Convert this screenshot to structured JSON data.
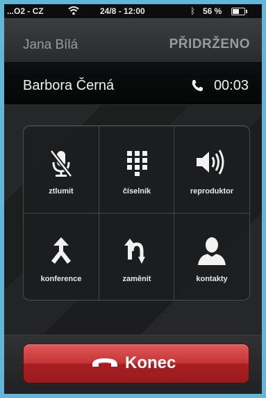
{
  "status_bar": {
    "carrier": "O2 - CZ",
    "signal_prefix": "...",
    "wifi_icon": "wifi-icon",
    "datetime": "24/8 - 12:00",
    "bluetooth_icon": "bluetooth-icon",
    "battery_percent": "56 %",
    "battery_level": 0.56
  },
  "held_call": {
    "name": "Jana Bílá",
    "status": "PŘIDRŽENO"
  },
  "active_call": {
    "name": "Barbora Černá",
    "duration": "00:03"
  },
  "controls": [
    {
      "label": "ztlumit",
      "icon": "mute-icon"
    },
    {
      "label": "číselník",
      "icon": "keypad-icon"
    },
    {
      "label": "reproduktor",
      "icon": "speaker-icon"
    },
    {
      "label": "konference",
      "icon": "merge-calls-icon"
    },
    {
      "label": "zaměnit",
      "icon": "swap-calls-icon"
    },
    {
      "label": "kontakty",
      "icon": "contacts-icon"
    }
  ],
  "end_call": {
    "label": "Konec"
  },
  "colors": {
    "frame": "#62b6d8",
    "end_red": "#c53537"
  }
}
